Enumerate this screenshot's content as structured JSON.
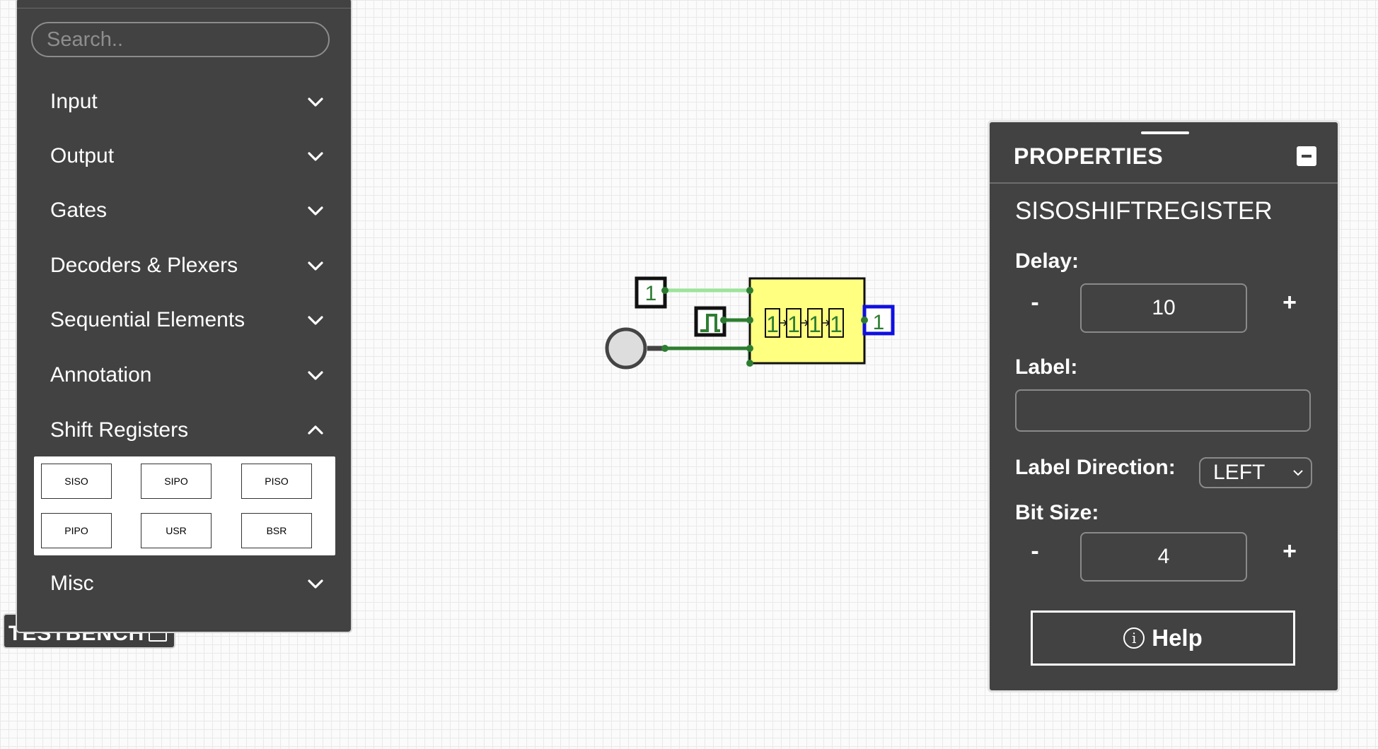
{
  "testbench": {
    "label": "TESTBENCH"
  },
  "sidebar": {
    "search_placeholder": "Search..",
    "categories": [
      {
        "label": "Input",
        "expanded": false
      },
      {
        "label": "Output",
        "expanded": false
      },
      {
        "label": "Gates",
        "expanded": false
      },
      {
        "label": "Decoders & Plexers",
        "expanded": false
      },
      {
        "label": "Sequential Elements",
        "expanded": false
      },
      {
        "label": "Annotation",
        "expanded": false
      },
      {
        "label": "Shift Registers",
        "expanded": true
      },
      {
        "label": "Misc",
        "expanded": false
      }
    ],
    "shift_registers": [
      "SISO",
      "SIPO",
      "PISO",
      "PIPO",
      "USR",
      "BSR"
    ]
  },
  "circuit": {
    "constant_input": "1",
    "register_bits": [
      "1",
      "1",
      "1",
      "1"
    ],
    "output_probe": "1",
    "colors": {
      "wire_high": "#2e7d32",
      "wire_low": "#9ae59a",
      "register_fill": "#ffff80",
      "probe_border": "#1010e0"
    }
  },
  "properties": {
    "title": "PROPERTIES",
    "element_name": "SISOSHIFTREGISTER",
    "delay_label": "Delay:",
    "delay_value": "10",
    "label_label": "Label:",
    "label_value": "",
    "label_direction_label": "Label Direction:",
    "label_direction_value": "LEFT",
    "bit_size_label": "Bit Size:",
    "bit_size_value": "4",
    "minus": "-",
    "plus": "+",
    "help_label": "Help",
    "info_glyph": "i"
  }
}
